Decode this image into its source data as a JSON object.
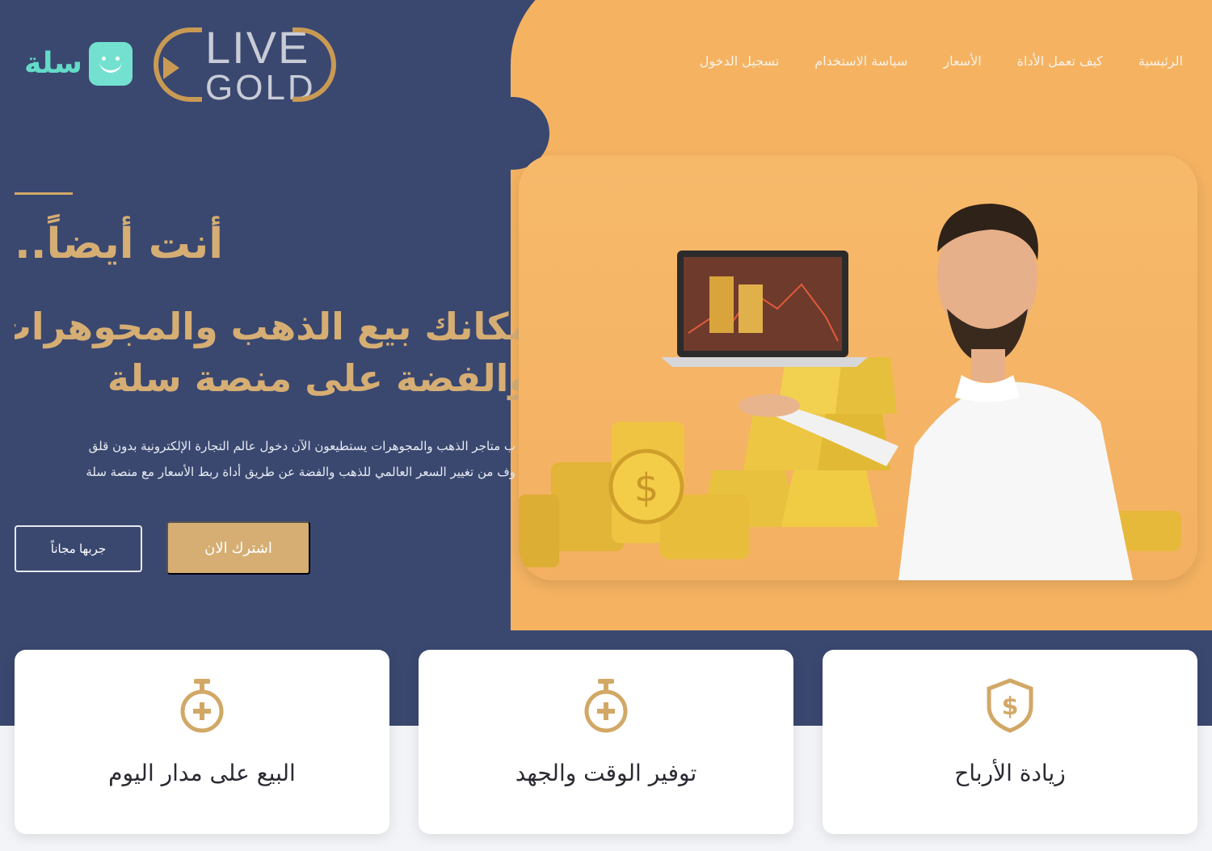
{
  "brand": {
    "salla_text": "سلة",
    "live_word": "LIVE",
    "gold_word": "GOLD"
  },
  "nav": [
    {
      "label": "الرئيسية"
    },
    {
      "label": "كيف تعمل الأداة"
    },
    {
      "label": "الأسعار"
    },
    {
      "label": "سياسة الاستخدام"
    },
    {
      "label": "تسجيل الدخول"
    }
  ],
  "hero": {
    "kicker": "أنت أيضاً..",
    "title_line1": "مكانك بيع الذهب والمجوهرات",
    "title_line2": "والفضة على منصة سلة",
    "desc_line1": "ب متاجر الذهب والمجوهرات يستطيعون الآن دخول عالم التجارة الإلكترونية بدون قلق",
    "desc_line2": "وف من تغيير السعر العالمي للذهب والفضة عن طريق أداة ربط الأسعار مع منصة سلة",
    "btn_secondary": "جربها مجاناً",
    "btn_primary": "اشترك الان"
  },
  "features": [
    {
      "label": "البيع على مدار اليوم",
      "icon": "stopwatch-icon"
    },
    {
      "label": "توفير الوقت والجهد",
      "icon": "stopwatch-icon"
    },
    {
      "label": "زيادة الأرباح",
      "icon": "dollar-shield-icon"
    }
  ],
  "colors": {
    "navy": "#3a4870",
    "orange": "#f5b362",
    "gold": "#d6ae73",
    "teal": "#64dbc8"
  }
}
